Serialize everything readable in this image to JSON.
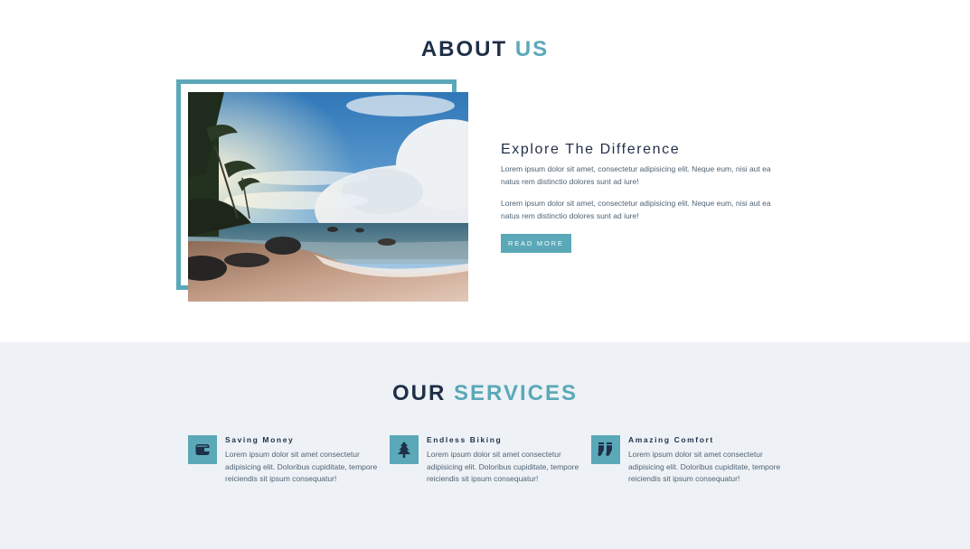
{
  "about": {
    "title_main": "ABOUT",
    "title_accent": "US",
    "heading": "Explore The Difference",
    "paragraph_1": "Lorem ipsum dolor sit amet, consectetur adipisicing elit. Neque eum, nisi aut ea natus rem distinctio dolores sunt ad iure!",
    "paragraph_2": "Lorem ipsum dolor sit amet, consectetur adipisicing elit. Neque eum, nisi aut ea natus rem distinctio dolores sunt ad iure!",
    "button_label": "READ MORE",
    "image": "beach-photo"
  },
  "services": {
    "title_main": "OUR",
    "title_accent": "SERVICES",
    "items": [
      {
        "title": "Saving Money",
        "text": "Lorem ipsum dolor sit amet consectetur adipisicing elit. Doloribus cupiditate, tempore reiciendis sit ipsum consequatur!",
        "icon": "wallet-icon"
      },
      {
        "title": "Endless Biking",
        "text": "Lorem ipsum dolor sit amet consectetur adipisicing elit. Doloribus cupiditate, tempore reiciendis sit ipsum consequatur!",
        "icon": "tree-icon"
      },
      {
        "title": "Amazing Comfort",
        "text": "Lorem ipsum dolor sit amet consectetur adipisicing elit. Doloribus cupiditate, tempore reiciendis sit ipsum consequatur!",
        "icon": "socks-icon"
      }
    ]
  },
  "colors": {
    "accent": "#5aa8b8",
    "dark": "#1f2f48",
    "services_background": "#eef2f6"
  }
}
